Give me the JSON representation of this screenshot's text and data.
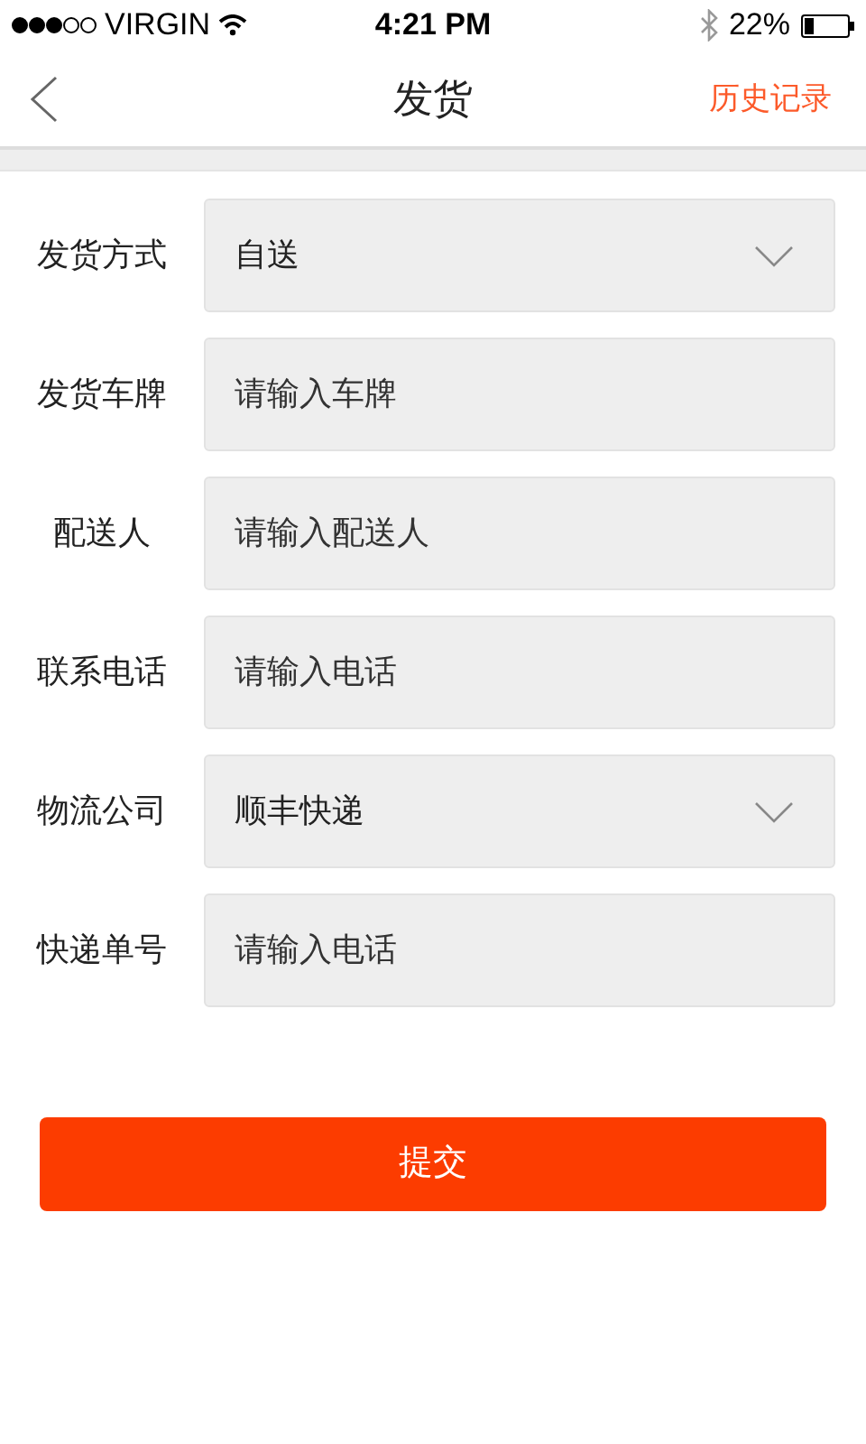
{
  "status_bar": {
    "carrier": "VIRGIN",
    "time": "4:21 PM",
    "battery": "22%"
  },
  "nav": {
    "title": "发货",
    "action": "历史记录"
  },
  "fields": [
    {
      "label": "发货方式",
      "kind": "select",
      "value": "自送"
    },
    {
      "label": "发货车牌",
      "kind": "input",
      "placeholder": "请输入车牌"
    },
    {
      "label": "配送人",
      "kind": "input",
      "placeholder": "请输入配送人"
    },
    {
      "label": "联系电话",
      "kind": "input",
      "placeholder": "请输入电话"
    },
    {
      "label": "物流公司",
      "kind": "select",
      "value": "顺丰快递"
    },
    {
      "label": "快递单号",
      "kind": "input",
      "placeholder": "请输入电话"
    }
  ],
  "submit": "提交"
}
